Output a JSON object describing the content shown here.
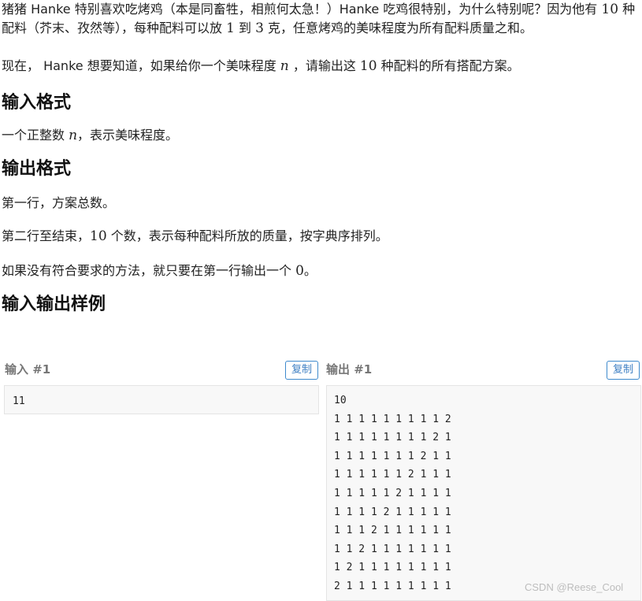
{
  "intro": {
    "p1_a": "猪猪 Hanke 特别喜欢吃烤鸡（本是同畜牲，相煎何太急！）Hanke 吃鸡很特别，为什么特别呢？因为他有 ",
    "p1_num_10": "10",
    "p1_b": " 种配料（芥末、孜然等），每种配料可以放 ",
    "p1_num_1": "1",
    "p1_c": " 到 ",
    "p1_num_3": "3",
    "p1_d": " 克，任意烤鸡的美味程度为所有配料质量之和。",
    "p2_a": "现在， Hanke 想要知道，如果给你一个美味程度 ",
    "p2_var": "n",
    "p2_b": " ，请输出这 ",
    "p2_num_10": "10",
    "p2_c": " 种配料的所有搭配方案。"
  },
  "input_format": {
    "heading": "输入格式",
    "text_a": "一个正整数 ",
    "var": "n",
    "text_b": "，表示美味程度。"
  },
  "output_format": {
    "heading": "输出格式",
    "line1": "第一行，方案总数。",
    "line2_a": "第二行至结束，",
    "line2_num": "10",
    "line2_b": " 个数，表示每种配料所放的质量，按字典序排列。",
    "line3_a": "如果没有符合要求的方法，就只要在第一行输出一个 ",
    "line3_num": "0",
    "line3_b": "。"
  },
  "samples": {
    "heading": "输入输出样例",
    "input_label": "输入 #1",
    "output_label": "输出 #1",
    "copy_label": "复制",
    "input_lines": [
      "11"
    ],
    "output_lines": [
      "10",
      "1 1 1 1 1 1 1 1 1 2",
      "1 1 1 1 1 1 1 1 2 1",
      "1 1 1 1 1 1 1 2 1 1",
      "1 1 1 1 1 1 2 1 1 1",
      "1 1 1 1 1 2 1 1 1 1",
      "1 1 1 1 2 1 1 1 1 1",
      "1 1 1 2 1 1 1 1 1 1",
      "1 1 2 1 1 1 1 1 1 1",
      "1 2 1 1 1 1 1 1 1 1",
      "2 1 1 1 1 1 1 1 1 1"
    ]
  },
  "watermark": "CSDN @Reese_Cool"
}
